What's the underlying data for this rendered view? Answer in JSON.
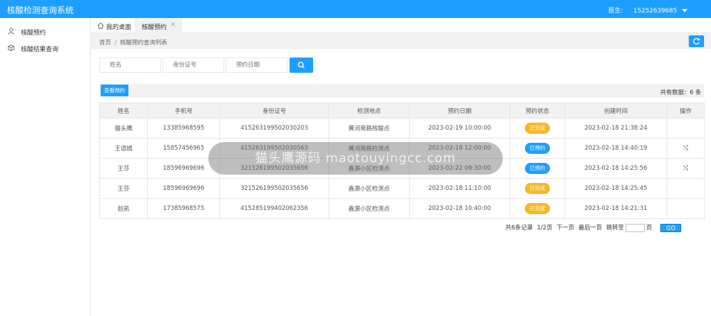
{
  "app": {
    "title": "核酸检测查询系统"
  },
  "header": {
    "user_label": "医生:",
    "phone": "15252639685"
  },
  "sidebar": {
    "items": [
      {
        "label": "核酸预约",
        "icon": "user-icon"
      },
      {
        "label": "核酸结果查询",
        "icon": "cube-icon"
      }
    ]
  },
  "tabs": [
    {
      "label": "我的桌面",
      "icon": "home-icon"
    },
    {
      "label": "核酸预约",
      "close": "×"
    }
  ],
  "breadcrumb": {
    "home": "首页",
    "sep": "/",
    "current": "核酸预约查询列表"
  },
  "search": {
    "name_placeholder": "姓名",
    "idcard_placeholder": "身份证号",
    "date_placeholder": "预约日期"
  },
  "toolbar": {
    "view_label": "查看预约",
    "total_text": "共有数据：6 条"
  },
  "table": {
    "headers": [
      "姓名",
      "手机号",
      "身份证号",
      "检测地点",
      "预约日期",
      "预约状态",
      "创建时间",
      "操作"
    ],
    "rows": [
      {
        "name": "猫头鹰",
        "phone": "13385968595",
        "idcard": "415263199502030203",
        "location": "黄河南路核酸点",
        "date": "2023-02-19 10:00:00",
        "status": "已完成",
        "status_type": "done",
        "created": "2023-02-18 21:38:24",
        "op": ""
      },
      {
        "name": "王语嫣",
        "phone": "15857456965",
        "idcard": "415263199502030563",
        "location": "黄河南路检测点",
        "date": "2023-02-18 12:00:00",
        "status": "已预约",
        "status_type": "booked",
        "created": "2023-02-18 14:40:19",
        "op": "⤭"
      },
      {
        "name": "王莎",
        "phone": "18596969696",
        "idcard": "321526199502035656",
        "location": "鑫源小区检测点",
        "date": "2023-02-22 09:30:00",
        "status": "已预约",
        "status_type": "booked",
        "created": "2023-02-18 14:25:56",
        "op": "⤭"
      },
      {
        "name": "王莎",
        "phone": "18596969696",
        "idcard": "321526199502035656",
        "location": "鑫源小区检测点",
        "date": "2023-02-18 11:10:00",
        "status": "已完成",
        "status_type": "done",
        "created": "2023-02-18 14:25:45",
        "op": ""
      },
      {
        "name": "赵凯",
        "phone": "17385968575",
        "idcard": "415285199402062356",
        "location": "鑫源小区检测点",
        "date": "2023-02-18 10:40:00",
        "status": "已完成",
        "status_type": "done",
        "created": "2023-02-18 14:21:31",
        "op": ""
      }
    ]
  },
  "pager": {
    "records": "共6条记录",
    "page": "1/2页",
    "next": "下一页",
    "last": "最后一页",
    "jump_label": "跳转至",
    "page_unit": "页",
    "go": "GO"
  },
  "watermark": {
    "text": "猫头鹰源码 maotouyingcc.com"
  },
  "colors": {
    "primary": "#1e9fff",
    "done": "#f7b824",
    "booked": "#1e9fff"
  }
}
